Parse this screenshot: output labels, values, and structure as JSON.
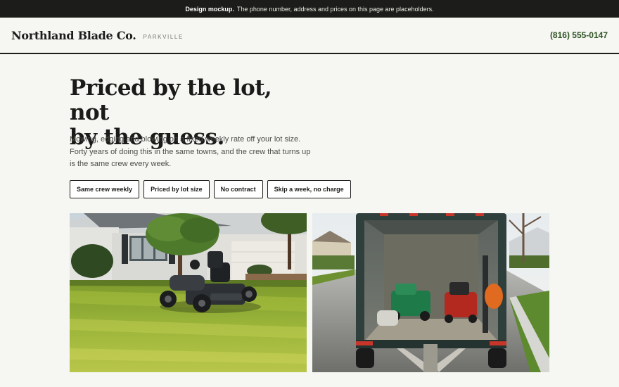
{
  "banner": {
    "bold": "Design mockup.",
    "text": "The phone number, address and prices on this page are placeholders."
  },
  "header": {
    "brand": "Northland Blade Co.",
    "location": "PARKVILLE",
    "phone": "(816) 555-0147"
  },
  "hero": {
    "lines": [
      "Priced by the lot, not",
      "by the guess."
    ]
  },
  "intro": {
    "lines": [
      "Mowing, edging and blowing on a fixed weekly rate off your lot size.",
      "Forty years of doing this in the same towns, and the crew that turns up",
      "is the same crew every week."
    ]
  },
  "chips": [
    "Same crew weekly",
    "Priced by lot size",
    "No contract",
    "Skip a week, no charge"
  ],
  "photos": [
    {
      "name": "riding-mower-lawn-photo"
    },
    {
      "name": "equipment-trailer-photo"
    }
  ],
  "colors": {
    "banner_bg": "#1c1c1a",
    "page_bg": "#f6f6f3",
    "phone": "#2f5424",
    "rule": "#1c1c1a"
  }
}
